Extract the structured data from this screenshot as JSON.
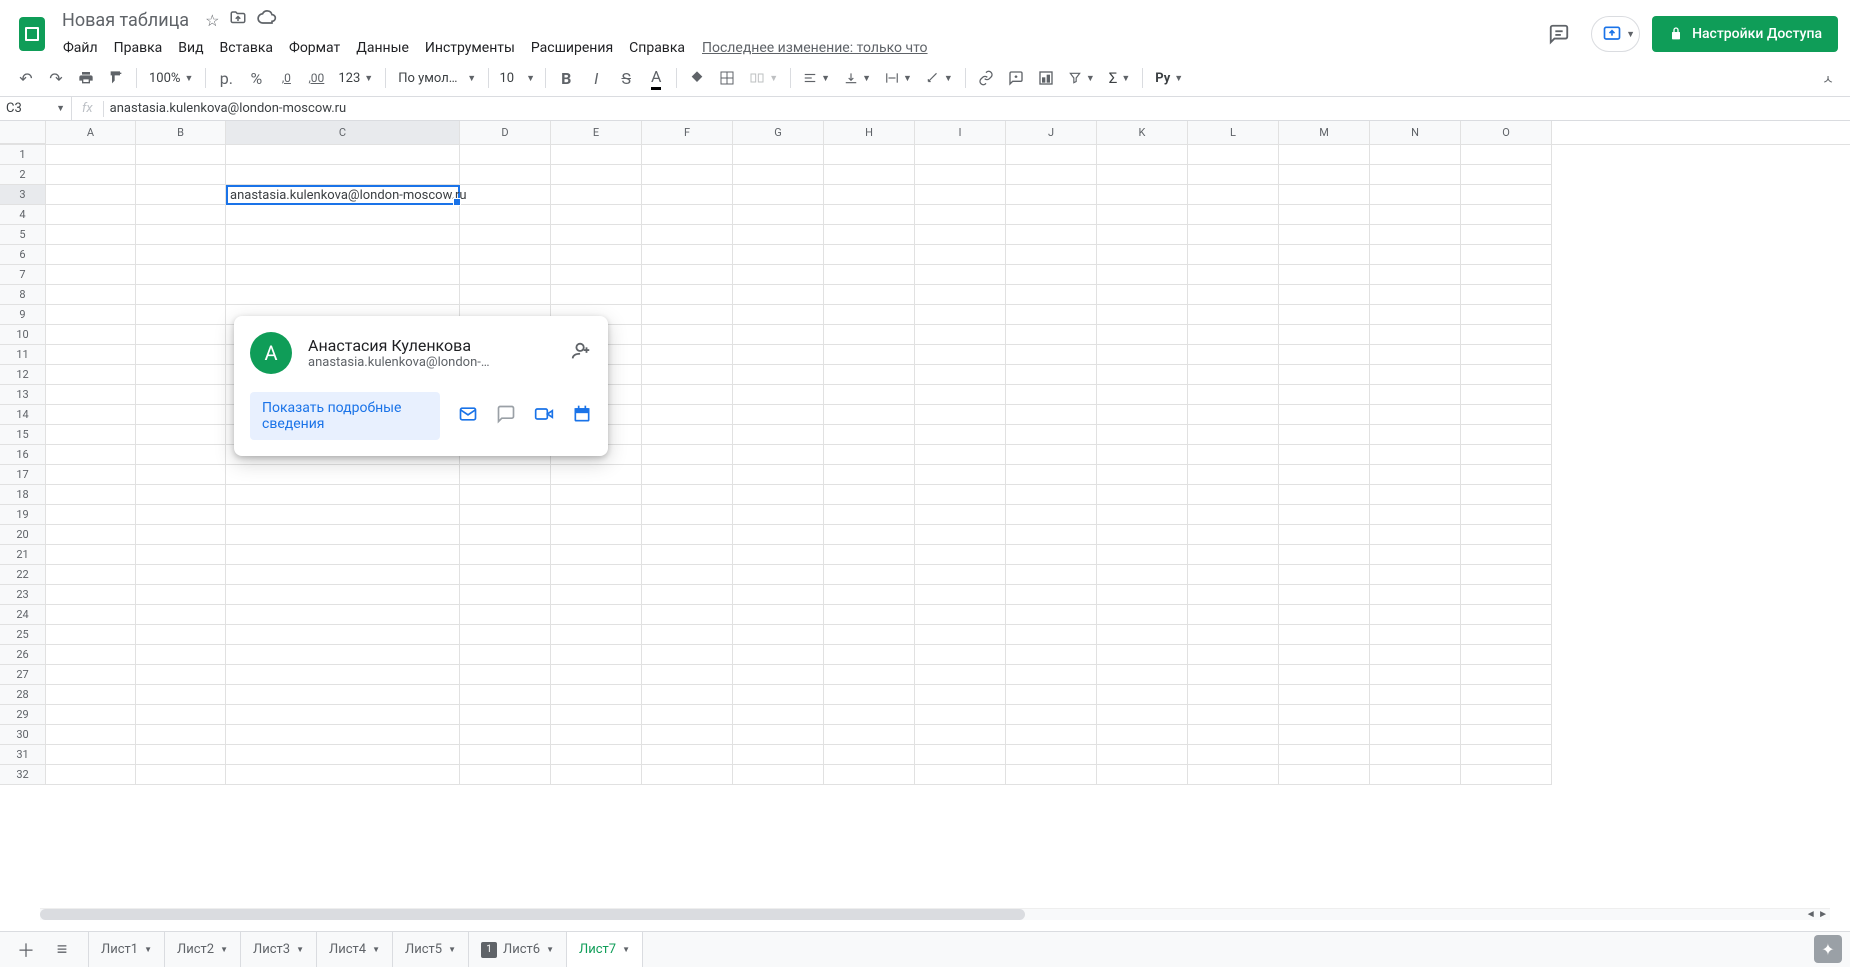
{
  "header": {
    "doc_title": "Новая таблица",
    "menu": [
      "Файл",
      "Правка",
      "Вид",
      "Вставка",
      "Формат",
      "Данные",
      "Инструменты",
      "Расширения",
      "Справка"
    ],
    "last_edit": "Последнее изменение: только что",
    "share_label": "Настройки Доступа"
  },
  "toolbar": {
    "zoom": "100%",
    "currency": "р.",
    "percent": "%",
    "dec_dec": ",0",
    "inc_dec": ",00",
    "more_formats": "123",
    "font": "По умолча...",
    "size": "10"
  },
  "formula": {
    "name_box": "C3",
    "fx": "fx",
    "value": "anastasia.kulenkova@london-moscow.ru"
  },
  "grid": {
    "columns": [
      "A",
      "B",
      "C",
      "D",
      "E",
      "F",
      "G",
      "H",
      "I",
      "J",
      "K",
      "L",
      "M",
      "N",
      "O"
    ],
    "row_count": 32,
    "active_cell": {
      "row": 3,
      "col": "C",
      "value": "anastasia.kulenkova@london-moscow.ru "
    }
  },
  "card": {
    "avatar_letter": "А",
    "name": "Анастасия Куленкова",
    "email": "anastasia.kulenkova@london-mosc…",
    "details_label": "Показать подробные сведения"
  },
  "tabs": {
    "items": [
      "Лист1",
      "Лист2",
      "Лист3",
      "Лист4",
      "Лист5",
      "Лист6",
      "Лист7"
    ],
    "active": "Лист7",
    "dark_icon_tab": "Лист6"
  }
}
